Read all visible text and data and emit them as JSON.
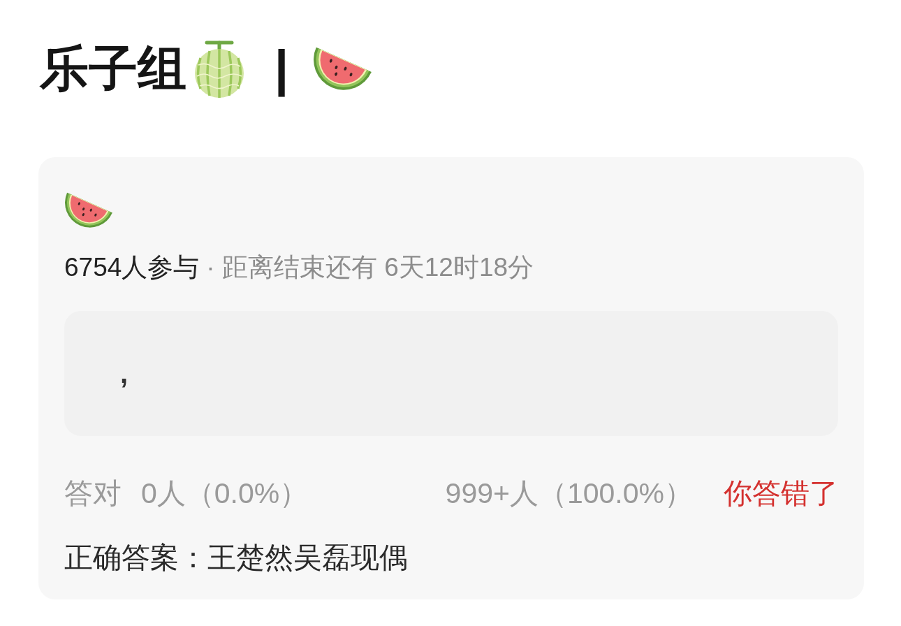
{
  "header": {
    "title": "乐子组",
    "separator": "|"
  },
  "poll": {
    "participants": "6754人参与",
    "countdown": "· 距离结束还有 6天12时18分",
    "answer_box": {
      "value": ","
    },
    "stats": {
      "correct_label": "答对",
      "correct_count": "0人（0.0%）",
      "wrong_count": "999+人（100.0%）",
      "result": "你答错了",
      "answered_correctly": false
    },
    "correct_answer": "正确答案：王楚然吴磊现偶"
  }
}
